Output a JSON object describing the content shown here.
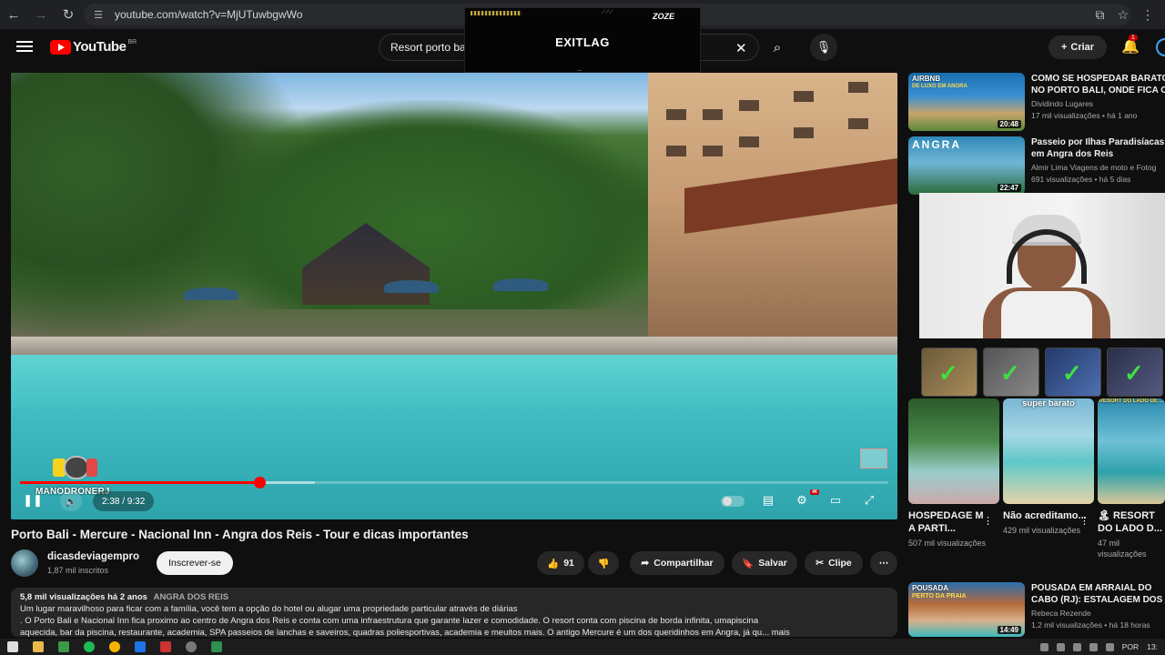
{
  "browser": {
    "url": "youtube.com/watch?v=MjUTuwbgwWo"
  },
  "header": {
    "logo_text": "YouTube",
    "country_code": "BR",
    "search_value": "Resort porto ba",
    "create_label": "Criar",
    "notification_count": "1"
  },
  "overlay": {
    "brand": "EXITLAG",
    "sponsor": "ZOZE",
    "dots": ".."
  },
  "player": {
    "time": "2:38 / 9:32",
    "progress_fraction": 0.2762,
    "buffer_fraction": 0.34,
    "streamer_name": "MANODRONERJ"
  },
  "video": {
    "title": "Porto Bali - Mercure - Nacional Inn - Angra dos Reis - Tour e dicas importantes",
    "channel_name": "dicasdeviagempro",
    "channel_subs": "1,87 mil inscritos",
    "subscribe_label": "Inscrever-se",
    "likes": "91",
    "share_label": "Compartilhar",
    "save_label": "Salvar",
    "clip_label": "Clipe",
    "description_meta": "5,8 mil visualizações  há 2 anos",
    "description_tag": "ANGRA DOS REIS",
    "description_line1": "Um lugar maravilhoso para ficar com a família, você tem a opção do hotel ou alugar uma  propriedade particular através de diárias",
    "description_line2": ". O Porto Bali e Nacional Inn fica proximo ao centro de Angra dos Reis e conta com uma infraestrutura que garante lazer e comodidade. O resort conta com piscina de borda infinita, umapiscina",
    "description_line3": "aquecida, bar da piscina, restaurante, academia, SPA passeios de lanchas e saveiros, quadras poliesportivas, academia e meuitos mais. O antigo Mercure é um dos queridinhos em Angra, já qu... mais"
  },
  "recommendations": [
    {
      "title1": "COMO SE HOSPEDAR BARATO",
      "title2": "NO PORTO BALI, ONDE FICA O",
      "channel": "Dividindo Lugares",
      "meta": "17 mil visualizações • há 1 ano",
      "duration": "20:48",
      "thumb_caption": "AIRBNB",
      "thumb_caption2": "DE LUXO EM ANGRA"
    },
    {
      "title1": "Passeio por Ilhas Paradisíacas",
      "title2": "em Angra dos Reis",
      "channel": "Almir Lima Viagens de moto e Fotog",
      "meta": "691 visualizações • há 5 dias",
      "duration": "22:47",
      "thumb_caption": "ANGRA"
    },
    {
      "title1": "POUSADA EM ARRAIAL DO",
      "title2": "CABO (RJ): ESTALAGEM DOS",
      "channel": "Rebeca Rezende",
      "meta": "1,2 mil visualizações • há 18 horas",
      "duration": "14:49",
      "thumb_caption": "POUSADA",
      "thumb_caption2": "PERTO DA PRAIA"
    }
  ],
  "shorts": [
    {
      "title": "HOSPEDAGE M A PARTI...",
      "views": "507 mil visualizações",
      "thumb_label": ""
    },
    {
      "title": "Não acreditamo...",
      "views": "429 mil visualizações",
      "thumb_label": "super barato"
    },
    {
      "title": "🏝 RESORT DO LADO D...",
      "views": "47 mil visualizações",
      "thumb_label": "RESORT DO LADO DE ..."
    }
  ],
  "taskbar": {
    "lang": "POR",
    "clock": "13:"
  }
}
